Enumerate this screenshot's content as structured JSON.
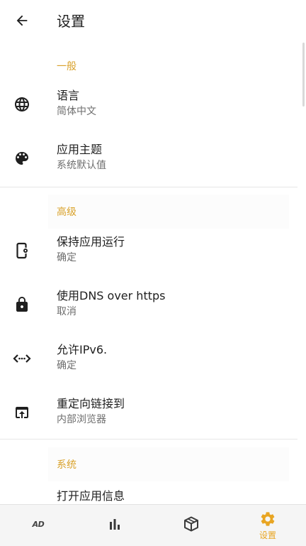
{
  "header": {
    "title": "设置",
    "back_icon": "arrow-left-icon"
  },
  "sections": [
    {
      "header": "一般",
      "items": [
        {
          "title": "语言",
          "subtitle": "简体中文",
          "icon": "globe-icon"
        },
        {
          "title": "应用主题",
          "subtitle": "系统默认值",
          "icon": "palette-icon"
        }
      ]
    },
    {
      "header": "高级",
      "items": [
        {
          "title": "保持应用运行",
          "subtitle": "确定",
          "icon": "phone-settings-icon"
        },
        {
          "title": "使用DNS over https",
          "subtitle": "取消",
          "icon": "lock-icon"
        },
        {
          "title": "允许IPv6.",
          "subtitle": "确定",
          "icon": "code-arrows-icon"
        },
        {
          "title": "重定向链接到",
          "subtitle": "内部浏览器",
          "icon": "open-in-browser-icon"
        }
      ]
    },
    {
      "header": "系统",
      "items": [
        {
          "title": "打开应用信息",
          "subtitle": "",
          "icon": ""
        }
      ]
    }
  ],
  "bottom_nav": {
    "items": [
      {
        "icon": "ad-block-icon",
        "text": "AD",
        "label": ""
      },
      {
        "icon": "bar-chart-icon",
        "label": ""
      },
      {
        "icon": "package-icon",
        "label": ""
      },
      {
        "icon": "gear-icon",
        "label": "设置",
        "active": true
      }
    ]
  },
  "colors": {
    "accent": "#e8a522",
    "section_header": "#d9a22b",
    "text_primary": "#1f1f1f",
    "text_secondary": "#6e6e6e"
  }
}
